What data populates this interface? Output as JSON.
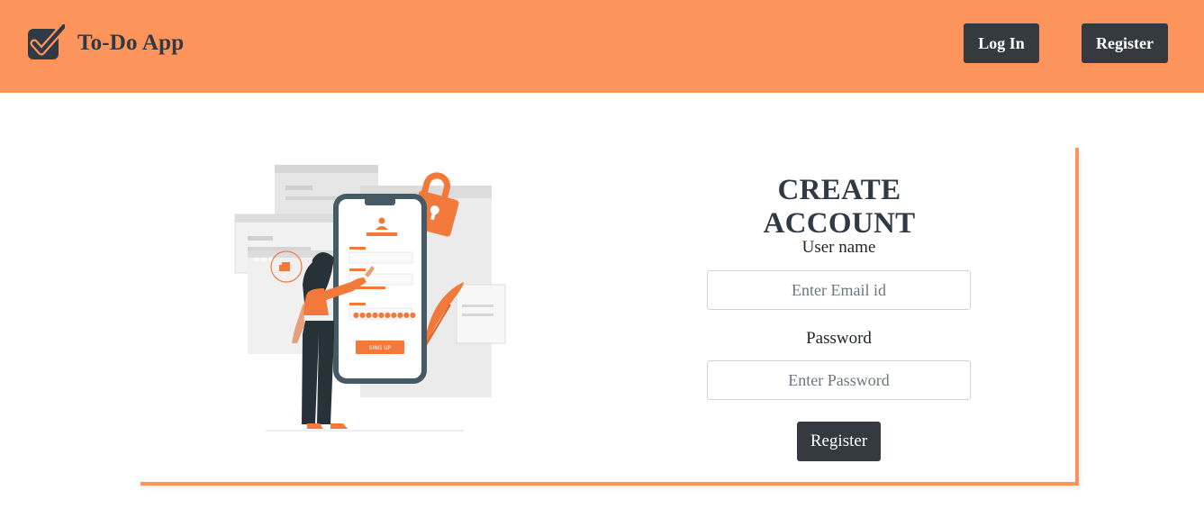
{
  "brand": {
    "name": "To-Do App",
    "logo_icon": "checkbox-check-icon"
  },
  "nav": {
    "login_label": "Log In",
    "register_label": "Register"
  },
  "illustration": {
    "icon": "signup-phone-illustration",
    "signup_button_text": "SING UP"
  },
  "form": {
    "title": "CREATE ACCOUNT",
    "username_label": "User name",
    "username_placeholder": "Enter Email id",
    "password_label": "Password",
    "password_placeholder": "Enter Password",
    "submit_label": "Register"
  },
  "colors": {
    "navbar_bg": "#fd945c",
    "accent_orange": "#f2793a",
    "button_dark": "#343a40",
    "heading_text": "#2f3a44"
  }
}
